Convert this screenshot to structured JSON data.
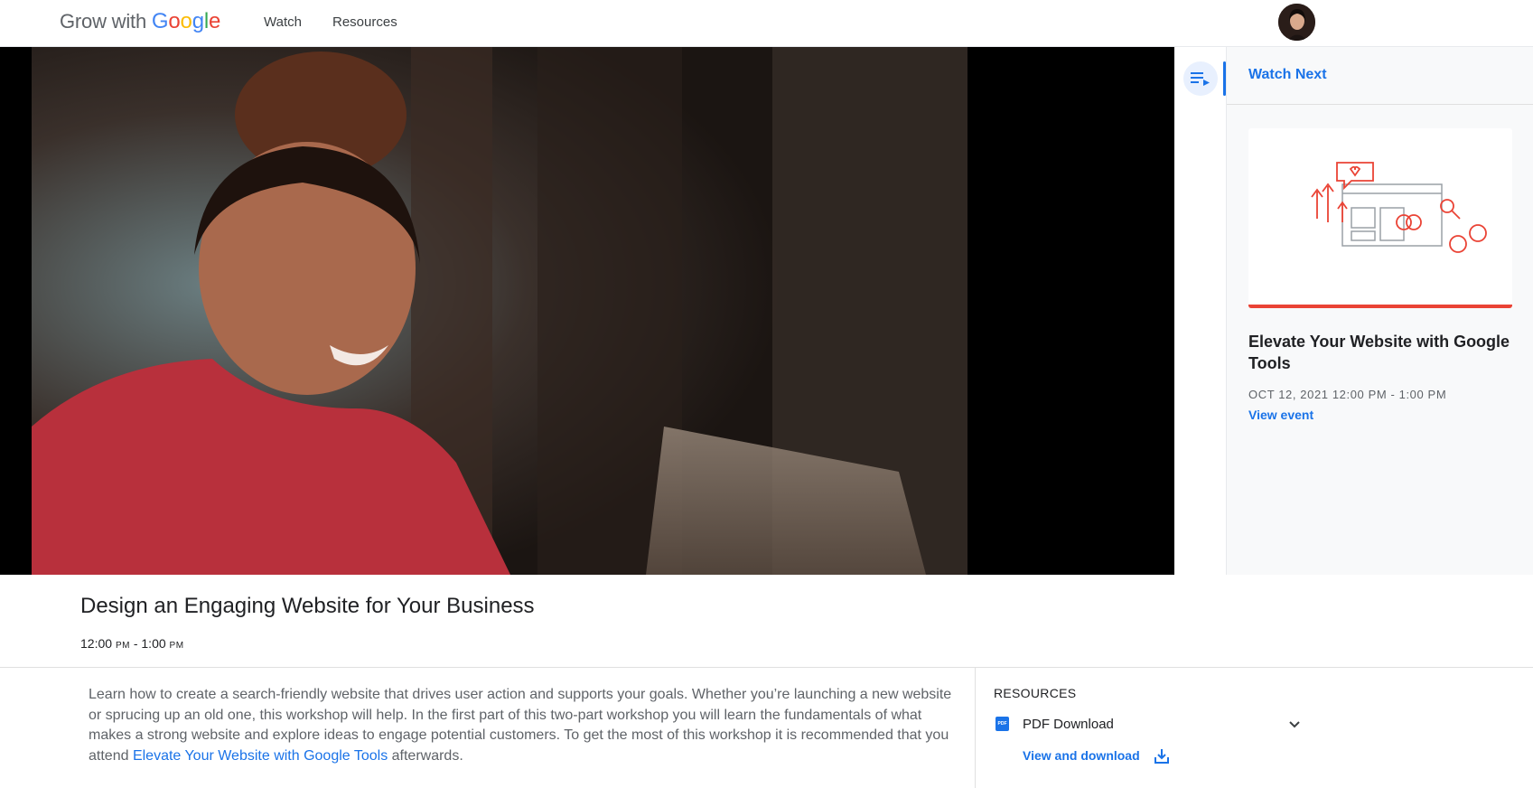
{
  "header": {
    "logo_prefix": "Grow with",
    "logo_word": [
      "G",
      "o",
      "o",
      "g",
      "l",
      "e"
    ],
    "nav": [
      "Watch",
      "Resources"
    ]
  },
  "video": {
    "icon": "video-still-image"
  },
  "watch_next": {
    "title": "Watch Next",
    "card_title": "Elevate Your Website with Google Tools",
    "card_date": "OCT 12, 2021 12:00 PM  - 1:00 PM",
    "card_link": "View event"
  },
  "event": {
    "title": "Design an Engaging Website for Your Business",
    "time_start": "12:00",
    "time_start_ampm": "PM",
    "time_sep": " - ",
    "time_end": "1:00",
    "time_end_ampm": "PM",
    "description_before": "Learn how to create a search-friendly website that drives user action and supports your goals. Whether you’re launching a new website or sprucing up an old one, this workshop will help. In the first part of this two-part workshop you will learn the fundamentals of what makes a strong website and explore ideas to engage potential customers. To get the most of this workshop it is recommended that you attend ",
    "description_link": "Elevate Your Website with Google Tools",
    "description_after": " afterwards."
  },
  "resources": {
    "label": "RESOURCES",
    "pdf_icon_text": "PDF",
    "item_label": "PDF Download",
    "view_download": "View and download"
  },
  "colors": {
    "accent": "#1a73e8",
    "card_bar": "#ea4335"
  }
}
